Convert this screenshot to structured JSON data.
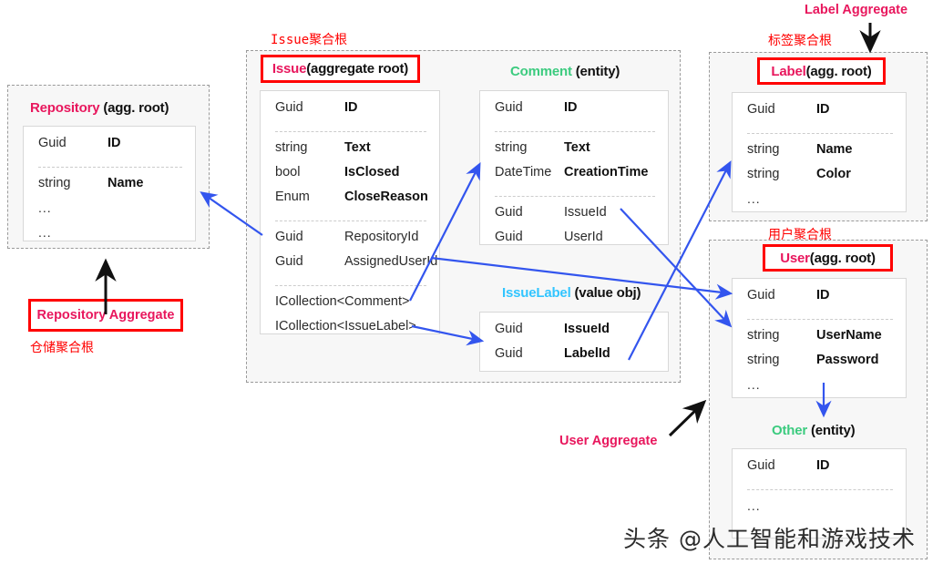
{
  "diagram": {
    "title": "DDD Aggregate Diagram",
    "colors": {
      "accent_pink": "#e8175d",
      "entity_green": "#3ccb7f",
      "value_cyan": "#32c5ff",
      "annotation_red": "#ff0000",
      "arrow_blue": "#3355ee",
      "container_bg": "#f7f7f7"
    }
  },
  "repository_aggregate": {
    "title_name": "Repository",
    "title_kind": " (agg. root)",
    "annotation_en": "Repository Aggregate",
    "annotation_cn": "仓储聚合根",
    "rows_group1": [
      {
        "type": "Guid",
        "name": "ID"
      }
    ],
    "rows_group2": [
      {
        "type": "string",
        "name": "Name"
      },
      {
        "type": "...",
        "name": ""
      },
      {
        "type": "...",
        "name": ""
      }
    ]
  },
  "issue_aggregate": {
    "annotation_cn": "Issue聚合根",
    "issue": {
      "title_name": "Issue",
      "title_kind": " (aggregate root)",
      "rows_group1": [
        {
          "type": "Guid",
          "name": "ID"
        }
      ],
      "rows_group2": [
        {
          "type": "string",
          "name": "Text"
        },
        {
          "type": "bool",
          "name": "IsClosed"
        },
        {
          "type": "Enum",
          "name": "CloseReason"
        }
      ],
      "rows_group3": [
        {
          "type": "Guid",
          "name": "RepositoryId"
        },
        {
          "type": "Guid",
          "name": "AssignedUserId"
        }
      ],
      "rows_group4": [
        {
          "type": "ICollection<Comment>",
          "name": ""
        },
        {
          "type": "ICollection<IssueLabel>",
          "name": ""
        }
      ]
    },
    "comment": {
      "title_name": "Comment",
      "title_kind": " (entity)",
      "rows_group1": [
        {
          "type": "Guid",
          "name": "ID"
        }
      ],
      "rows_group2": [
        {
          "type": "string",
          "name": "Text"
        },
        {
          "type": "DateTime",
          "name": "CreationTime"
        }
      ],
      "rows_group3": [
        {
          "type": "Guid",
          "name": "IssueId"
        },
        {
          "type": "Guid",
          "name": "UserId"
        }
      ]
    },
    "issuelabel": {
      "title_name": "IssueLabel",
      "title_kind": " (value obj)",
      "rows_group1": [
        {
          "type": "Guid",
          "name": "IssueId"
        },
        {
          "type": "Guid",
          "name": "LabelId"
        }
      ]
    }
  },
  "label_aggregate": {
    "annotation_en": "Label Aggregate",
    "annotation_cn": "标签聚合根",
    "title_name": "Label",
    "title_kind": " (agg. root)",
    "rows_group1": [
      {
        "type": "Guid",
        "name": "ID"
      }
    ],
    "rows_group2": [
      {
        "type": "string",
        "name": "Name"
      },
      {
        "type": "string",
        "name": "Color"
      },
      {
        "type": "...",
        "name": ""
      }
    ]
  },
  "user_aggregate": {
    "annotation_en": "User Aggregate",
    "annotation_cn": "用户聚合根",
    "user": {
      "title_name": "User",
      "title_kind": " (agg. root)",
      "rows_group1": [
        {
          "type": "Guid",
          "name": "ID"
        }
      ],
      "rows_group2": [
        {
          "type": "string",
          "name": "UserName"
        },
        {
          "type": "string",
          "name": "Password"
        },
        {
          "type": "...",
          "name": ""
        }
      ]
    },
    "other": {
      "title_name": "Other",
      "title_kind": " (entity)",
      "rows_group1": [
        {
          "type": "Guid",
          "name": "ID"
        }
      ],
      "rows_group2": [
        {
          "type": "...",
          "name": ""
        }
      ]
    }
  },
  "watermark": "头条 @人工智能和游戏技术"
}
